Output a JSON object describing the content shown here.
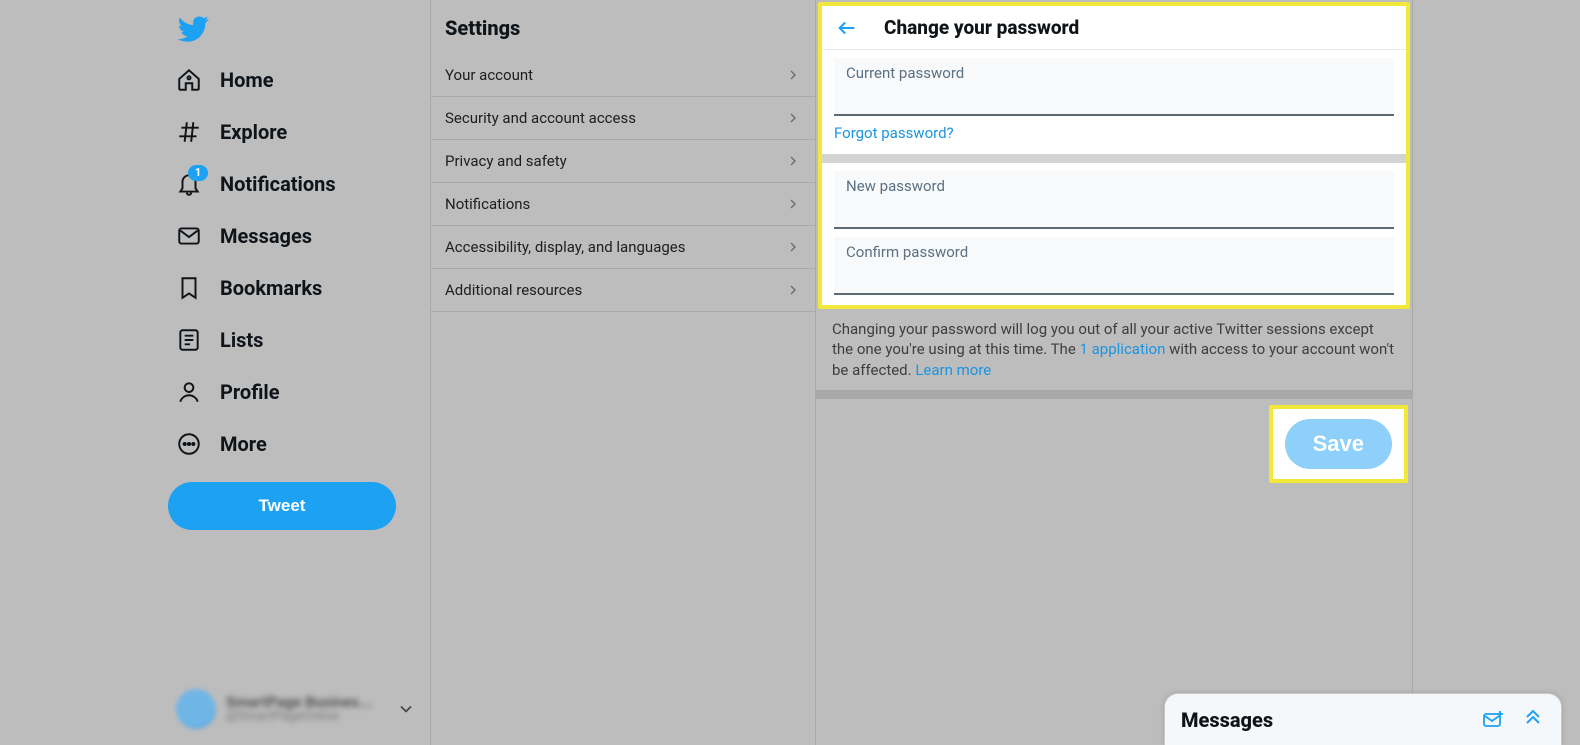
{
  "brand": {
    "name": "Twitter"
  },
  "nav": {
    "items": [
      {
        "label": "Home"
      },
      {
        "label": "Explore"
      },
      {
        "label": "Notifications",
        "badge": "1"
      },
      {
        "label": "Messages"
      },
      {
        "label": "Bookmarks"
      },
      {
        "label": "Lists"
      },
      {
        "label": "Profile"
      },
      {
        "label": "More"
      }
    ],
    "tweet_label": "Tweet"
  },
  "account": {
    "display_name": "SmartPage Busines...",
    "handle": "@SmartPageOnline"
  },
  "settings": {
    "title": "Settings",
    "items": [
      {
        "label": "Your account"
      },
      {
        "label": "Security and account access"
      },
      {
        "label": "Privacy and safety"
      },
      {
        "label": "Notifications"
      },
      {
        "label": "Accessibility, display, and languages"
      },
      {
        "label": "Additional resources"
      }
    ]
  },
  "detail": {
    "title": "Change your password",
    "current_label": "Current password",
    "current_value": "",
    "forgot_label": "Forgot password?",
    "new_label": "New password",
    "new_value": "",
    "confirm_label": "Confirm password",
    "confirm_value": "",
    "note_before": "Changing your password will log you out of all your active Twitter sessions except the one you're using at this time. The ",
    "note_link1": "1 application",
    "note_mid": " with access to your account won't be affected. ",
    "note_link2": "Learn more",
    "save_label": "Save"
  },
  "drawer": {
    "title": "Messages"
  }
}
